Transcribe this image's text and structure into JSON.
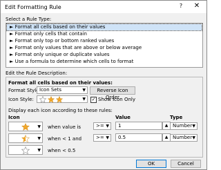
{
  "window": {
    "title": "Edit Formatting Rule",
    "help": "?",
    "close": "✕"
  },
  "rule_type": {
    "heading": "Select a Rule Type:",
    "items": [
      "Format all cells based on their values",
      "Format only cells that contain",
      "Format only top or bottom ranked values",
      "Format only values that are above or below average",
      "Format only unique or duplicate values",
      "Use a formula to determine which cells to format"
    ],
    "bullet": "►"
  },
  "description": {
    "heading": "Edit the Rule Description:",
    "subheading": "Format all cells based on their values:",
    "format_style_label": "Format Style:",
    "format_style_value": "Icon Sets",
    "reverse_button": "Reverse Icon Order",
    "icon_style_label": "Icon Style:",
    "show_icon_only_label": "Show Icon Only",
    "show_icon_only_checked": true,
    "display_text": "Display each icon according to these rules:",
    "col_icon": "Icon",
    "col_value": "Value",
    "col_type": "Type",
    "rows": [
      {
        "icon": "star-full",
        "when": "when value is",
        "op": ">=",
        "value": "1",
        "type": "Number"
      },
      {
        "icon": "star-half",
        "when": "when < 1 and",
        "op": ">=",
        "value": "0.5",
        "type": "Number"
      },
      {
        "icon": "star-empty",
        "when": "when < 0.5",
        "op": "",
        "value": "",
        "type": ""
      }
    ]
  },
  "footer": {
    "ok": "OK",
    "cancel": "Cancel"
  },
  "colors": {
    "star": "#f2a72a",
    "star_outline": "#9a9a9a",
    "selection": "#cfe3f7",
    "accent": "#0078d7"
  }
}
